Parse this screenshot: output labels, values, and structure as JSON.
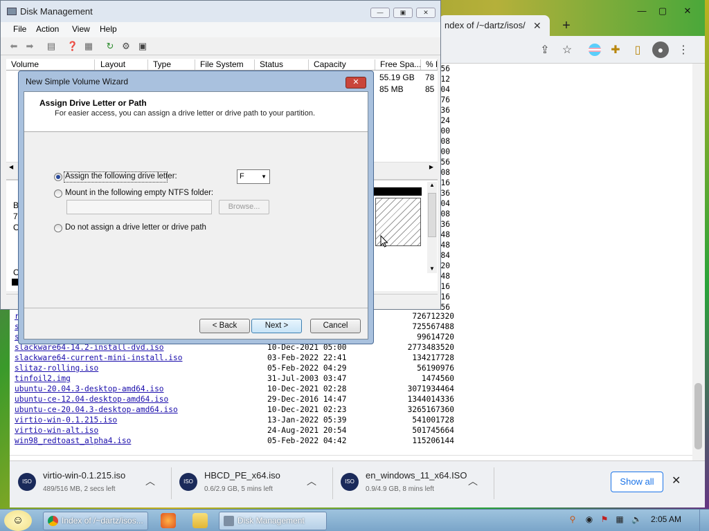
{
  "chrome": {
    "tab_title": "ndex of /~dartz/isos/",
    "tab_close": "✕",
    "new_tab": "+",
    "window_minimize": "—",
    "window_maximize": "▢",
    "window_close": "✕",
    "toolbar_icons": [
      "share-icon",
      "star-icon",
      "flag-icon",
      "extensions-icon",
      "sidebar-icon",
      "profile-icon",
      "menu-icon"
    ],
    "partial_numbers": [
      "56",
      "12",
      "04",
      "76",
      "36",
      "24",
      "00",
      "08",
      "00",
      "56",
      "08",
      "16",
      "36",
      "04",
      "08",
      "36",
      "48",
      "48",
      "84",
      "20",
      "48",
      "16",
      "16",
      "56"
    ],
    "listing": [
      {
        "name": "r",
        "date": "",
        "size": "726712320"
      },
      {
        "name": "s",
        "date": "",
        "size": "725567488"
      },
      {
        "name": "s",
        "date": "",
        "size": "99614720"
      },
      {
        "name": "slackware64-14.2-install-dvd.iso",
        "date": "10-Dec-2021 05:00",
        "size": "2773483520"
      },
      {
        "name": "slackware64-current-mini-install.iso",
        "date": "03-Feb-2022 22:41",
        "size": "134217728"
      },
      {
        "name": "slitaz-rolling.iso",
        "date": "05-Feb-2022 04:29",
        "size": "56190976"
      },
      {
        "name": "tinfoil2.img",
        "date": "31-Jul-2003 03:47",
        "size": "1474560"
      },
      {
        "name": "ubuntu-20.04.3-desktop-amd64.iso",
        "date": "10-Dec-2021 02:28",
        "size": "3071934464"
      },
      {
        "name": "ubuntu-ce-12.04-desktop-amd64.iso",
        "date": "29-Dec-2016 14:47",
        "size": "1344014336"
      },
      {
        "name": "ubuntu-ce-20.04.3-desktop-amd64.iso",
        "date": "10-Dec-2021 02:23",
        "size": "3265167360"
      },
      {
        "name": "virtio-win-0.1.215.iso",
        "date": "13-Jan-2022 05:39",
        "size": "541001728"
      },
      {
        "name": "virtio-win-alt.iso",
        "date": "24-Aug-2021 20:54",
        "size": "501745664"
      },
      {
        "name": "win98_redtoast_alpha4.iso",
        "date": "05-Feb-2022 04:42",
        "size": "115206144"
      }
    ],
    "downloads": [
      {
        "name": "virtio-win-0.1.215.iso",
        "progress": "489/516 MB, 2 secs left",
        "icon_label": "ISO"
      },
      {
        "name": "HBCD_PE_x64.iso",
        "progress": "0.6/2.9 GB, 5 mins left",
        "icon_label": "ISO"
      },
      {
        "name": "en_windows_11_x64.ISO",
        "progress": "0.9/4.9 GB, 8 mins left",
        "icon_label": "ISO"
      }
    ],
    "show_all": "Show all",
    "close_downloads": "✕"
  },
  "disk_management": {
    "title": "Disk Management",
    "menu": [
      "File",
      "Action",
      "View",
      "Help"
    ],
    "columns": [
      "Volume",
      "Layout",
      "Type",
      "File System",
      "Status",
      "Capacity",
      "Free Spa...",
      "% F"
    ],
    "rows": [
      {
        "free": "55.19 GB",
        "pct": "78"
      },
      {
        "free": "85 MB",
        "pct": "85"
      }
    ],
    "side_text": [
      "B",
      "7:",
      "O"
    ],
    "legend_char": "C"
  },
  "wizard": {
    "title": "New Simple Volume Wizard",
    "heading": "Assign Drive Letter or Path",
    "subheading": "For easier access, you can assign a drive letter or drive path to your partition.",
    "option_assign": "Assign the following drive letter:",
    "option_mount": "Mount in the following empty NTFS folder:",
    "option_none": "Do not assign a drive letter or drive path",
    "drive_letter": "F",
    "browse": "Browse...",
    "back": "< Back",
    "next": "Next >",
    "cancel": "Cancel",
    "selected_option": "assign"
  },
  "taskbar": {
    "buttons": [
      {
        "label": "Index of /~dartz/isos..."
      },
      {
        "label": "Disk Management"
      }
    ],
    "clock": "2:05 AM"
  }
}
